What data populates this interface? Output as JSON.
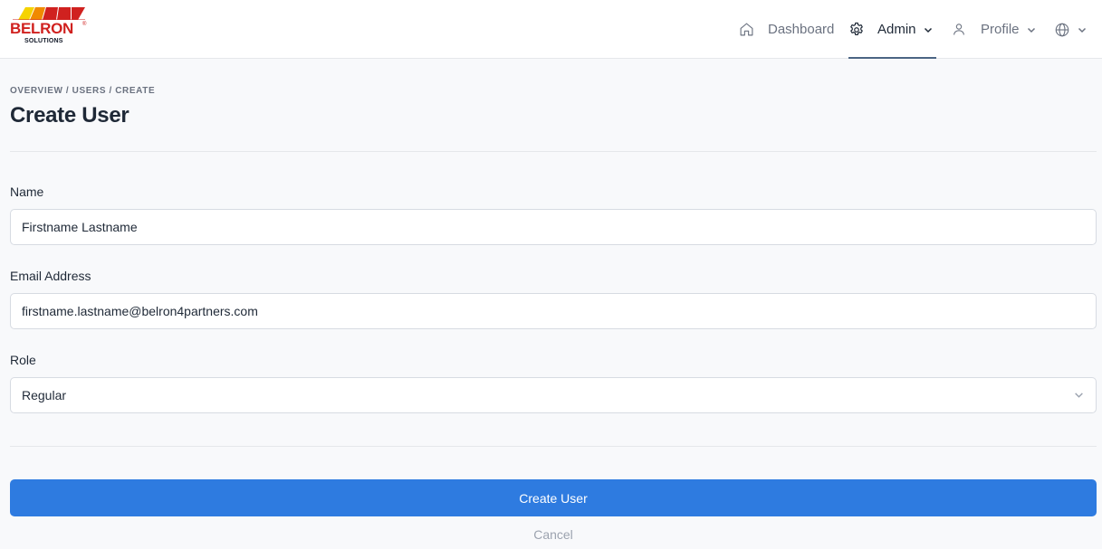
{
  "brand": {
    "name": "BELRON",
    "sub": "SOLUTIONS",
    "reg": "®"
  },
  "nav": {
    "dashboard": "Dashboard",
    "admin": "Admin",
    "profile": "Profile"
  },
  "breadcrumb": "OVERVIEW / USERS / CREATE",
  "page_title": "Create User",
  "form": {
    "name": {
      "label": "Name",
      "value": "Firstname Lastname"
    },
    "email": {
      "label": "Email Address",
      "value": "firstname.lastname@belron4partners.com"
    },
    "role": {
      "label": "Role",
      "value": "Regular"
    }
  },
  "actions": {
    "submit": "Create User",
    "cancel": "Cancel"
  },
  "colors": {
    "primary": "#2e7be0",
    "brand_red": "#d0211f"
  }
}
